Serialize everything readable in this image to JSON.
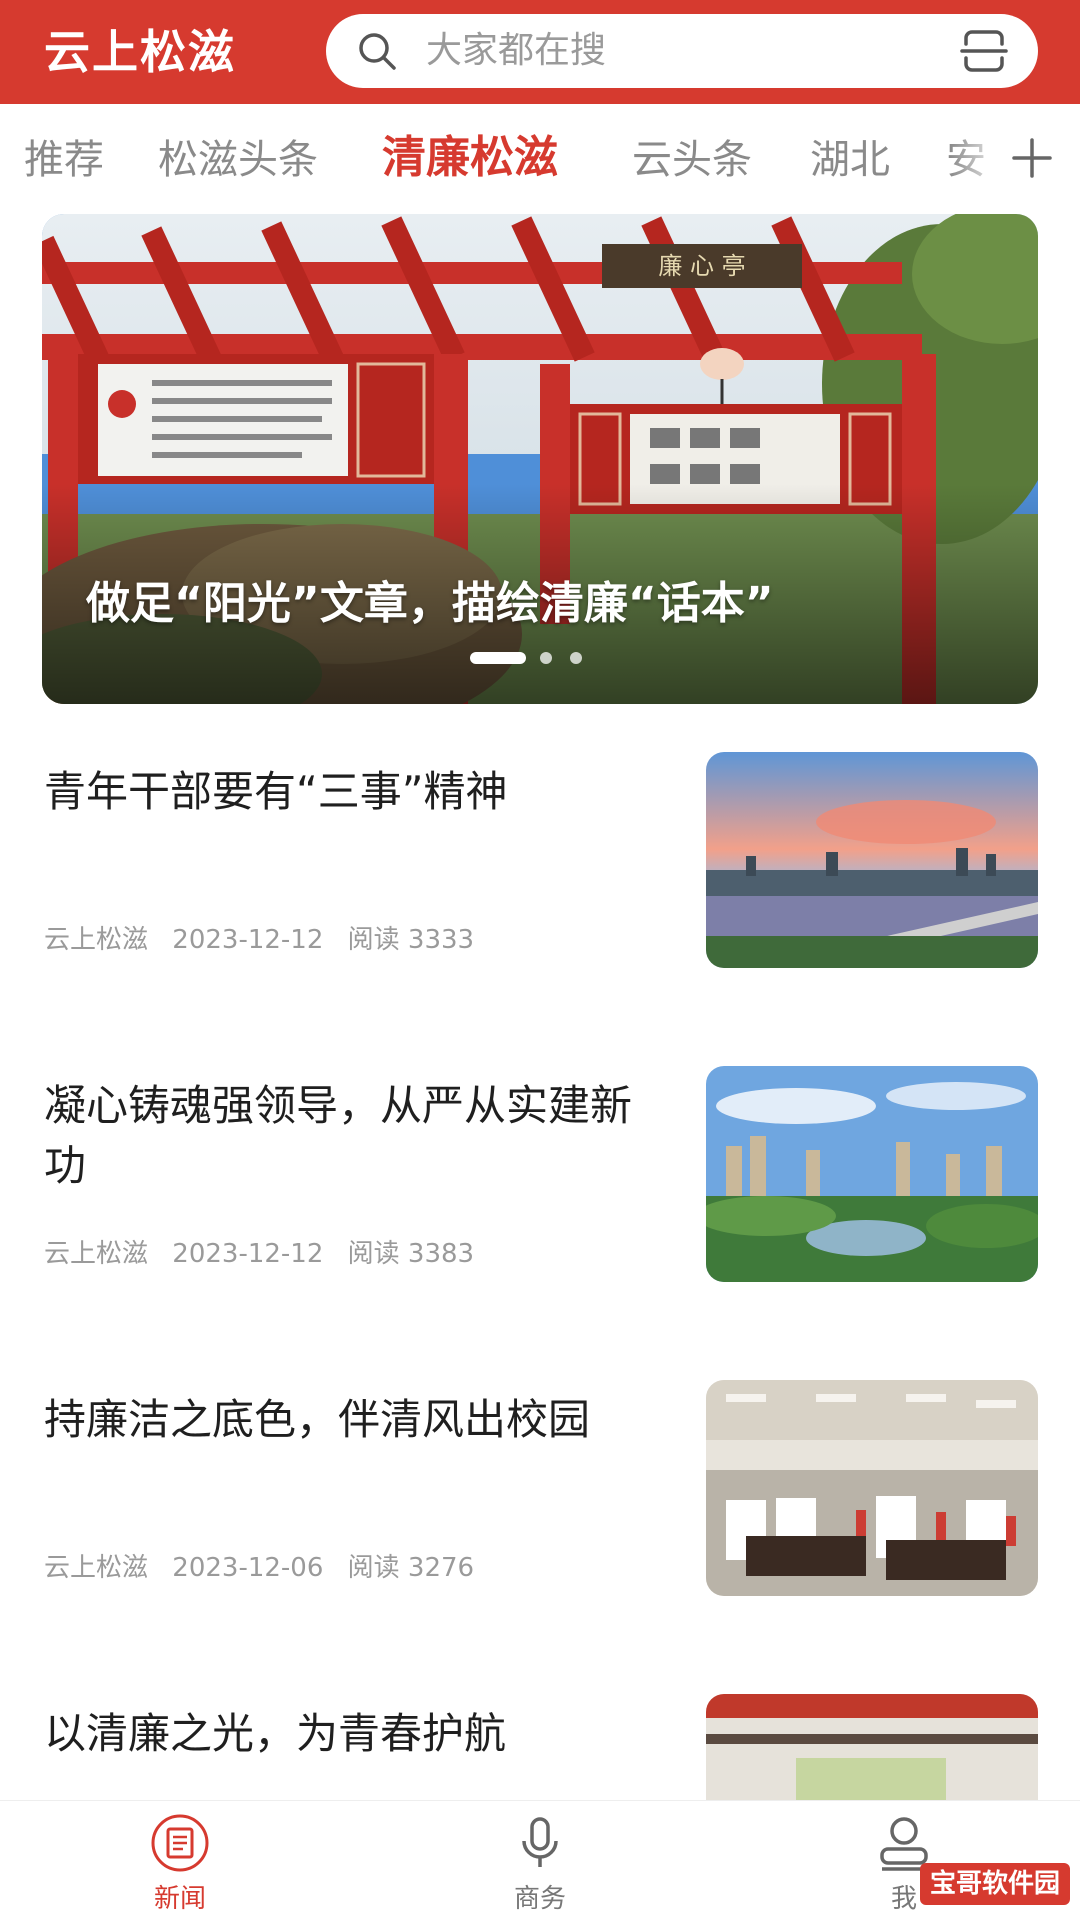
{
  "header": {
    "app_title": "云上松滋",
    "search_placeholder": "大家都在搜"
  },
  "tabs": [
    {
      "label": "推荐",
      "active": false
    },
    {
      "label": "松滋头条",
      "active": false
    },
    {
      "label": "清廉松滋",
      "active": true
    },
    {
      "label": "云头条",
      "active": false
    },
    {
      "label": "湖北",
      "active": false
    },
    {
      "label": "安",
      "active": false
    }
  ],
  "banner": {
    "caption": "做足“阳光”文章，描绘清廉“话本”",
    "sign_text": "廉 心 亭",
    "slides": 3,
    "active_slide": 1
  },
  "news": [
    {
      "title": "青年干部要有“三事”精神",
      "source": "云上松滋",
      "date": "2023-12-12",
      "reads": "阅读 3333"
    },
    {
      "title": "凝心铸魂强领导，从严从实建新功",
      "source": "云上松滋",
      "date": "2023-12-12",
      "reads": "阅读 3383"
    },
    {
      "title": "持廉洁之底色，伴清风出校园",
      "source": "云上松滋",
      "date": "2023-12-06",
      "reads": "阅读 3276"
    },
    {
      "title": "以清廉之光，为青春护航",
      "source": "",
      "date": "",
      "reads": ""
    }
  ],
  "bottom_nav": [
    {
      "label": "新闻",
      "icon": "newspaper-icon",
      "active": true
    },
    {
      "label": "商务",
      "icon": "microphone-icon",
      "active": false
    },
    {
      "label": "我",
      "icon": "user-icon",
      "active": false
    }
  ],
  "watermark": "宝哥软件园",
  "colors": {
    "brand_red": "#d63a2f",
    "muted_gray": "#9a9a9a"
  }
}
